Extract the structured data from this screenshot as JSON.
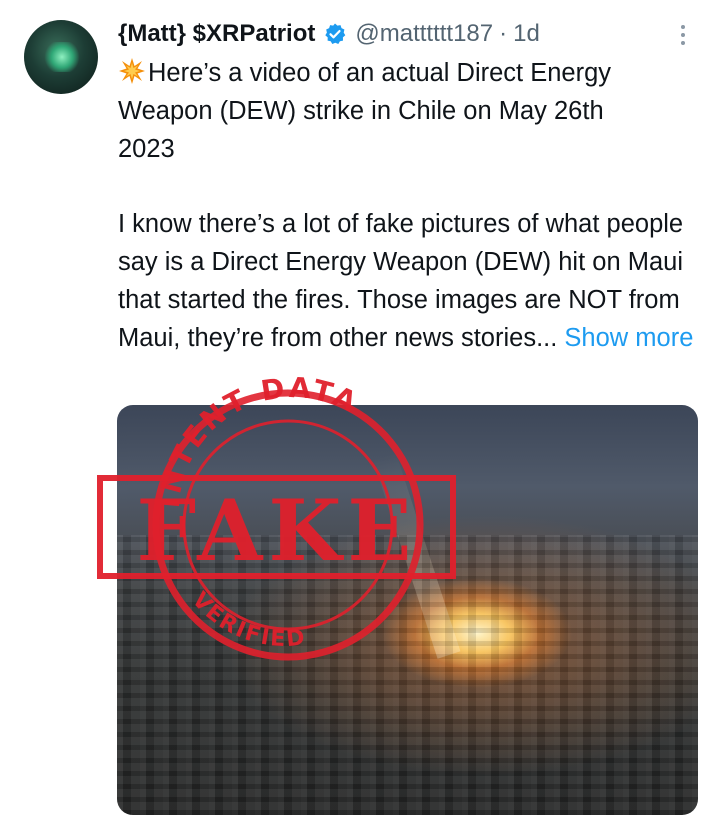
{
  "tweet": {
    "display_name": "{Matt} $XRPatriot",
    "handle": "@matttttt187",
    "separator": "·",
    "time": "1d",
    "line1_after_icon": "Here’s a video of an actual Direct Energy",
    "line2": "Weapon (DEW) strike in Chile on May 26th",
    "line3": "2023",
    "para2": "I know there’s a lot of fake pictures of what people say is a Direct Energy Weapon (DEW) hit on Maui that started the fires. Those images are NOT from Maui, they’re from other news stories...",
    "show_more": "Show more"
  },
  "stamp": {
    "main": "FAKE",
    "top_arc": "INTENT DATA",
    "bottom_arc": "VERIFIED",
    "color": "#e0202c"
  },
  "icons": {
    "avatar": "avatar-image",
    "verified": "verified-badge-icon",
    "more": "more-options-icon",
    "inline": "collision-emoji-icon"
  },
  "colors": {
    "link": "#1d9bf0",
    "verified": "#1d9bf0",
    "secondary_text": "#536471"
  }
}
